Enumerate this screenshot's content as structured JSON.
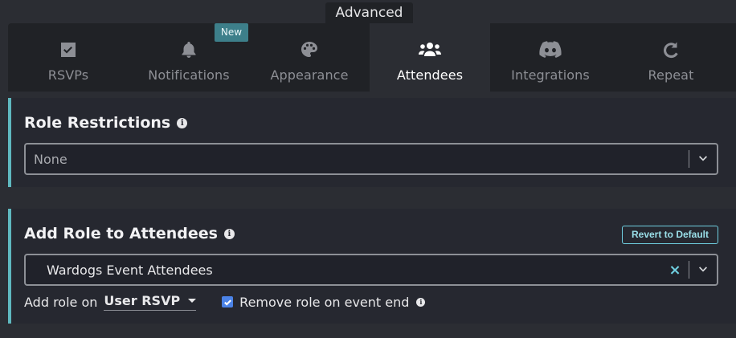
{
  "header": {
    "advanced_label": "Advanced"
  },
  "tabs": [
    {
      "id": "rsvps",
      "label": "RSVPs",
      "icon": "checkbox-icon",
      "active": false
    },
    {
      "id": "notifications",
      "label": "Notifications",
      "icon": "bell-icon",
      "active": false,
      "badge": "New"
    },
    {
      "id": "appearance",
      "label": "Appearance",
      "icon": "palette-icon",
      "active": false
    },
    {
      "id": "attendees",
      "label": "Attendees",
      "icon": "users-icon",
      "active": true
    },
    {
      "id": "integrations",
      "label": "Integrations",
      "icon": "discord-icon",
      "active": false
    },
    {
      "id": "repeat",
      "label": "Repeat",
      "icon": "redo-icon",
      "active": false
    }
  ],
  "role_restrictions": {
    "title": "Role Restrictions",
    "select_value": "None"
  },
  "add_role": {
    "title": "Add Role to Attendees",
    "revert_label": "Revert to Default",
    "select_value": "Wardogs Event Attendees",
    "clear_symbol": "×",
    "add_on_label": "Add role on",
    "add_on_value": "User RSVP",
    "remove_label": "Remove role on event end",
    "remove_checked": true
  },
  "colors": {
    "accent": "#5fb8bf",
    "badge": "#3d7f8a",
    "checkbox": "#4b83e8",
    "link": "#6fcfe0"
  }
}
